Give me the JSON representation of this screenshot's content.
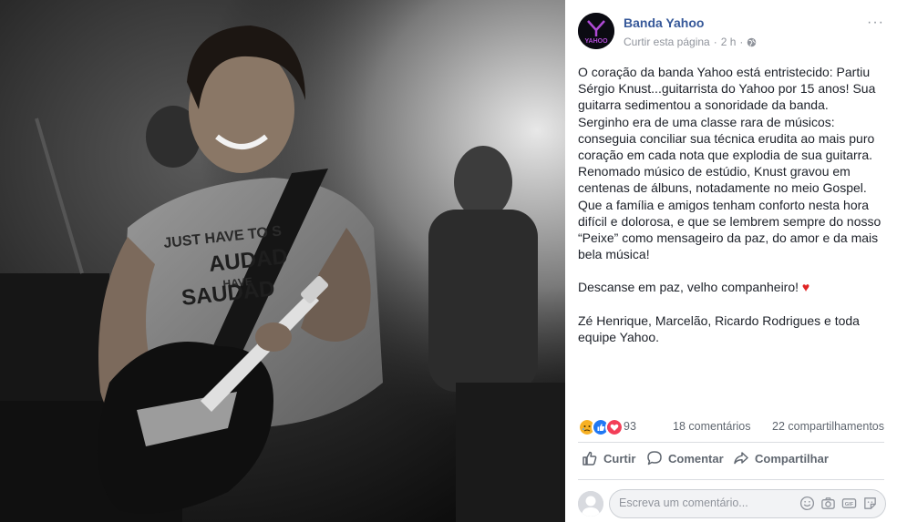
{
  "photo": {
    "shirt_text_1": "JUST HAVE TO S",
    "shirt_text_2": "AUDAD",
    "shirt_text_3": "HAVE",
    "shirt_text_4": "SAUDAD"
  },
  "post": {
    "page_name": "Banda Yahoo",
    "avatar_text": "YAHOO",
    "like_page_label": "Curtir esta página",
    "separator": "·",
    "time": "2 h",
    "separator2": "·",
    "more_label": "···",
    "paragraphs": [
      "O coração da banda Yahoo está entristecido: Partiu Sérgio Knust...guitarrista do Yahoo por 15 anos! Sua guitarra sedimentou a sonoridade da banda. Serginho era de uma classe rara de músicos: conseguia conciliar sua técnica erudita ao mais puro coração em cada nota que explodia de sua guitarra. Renomado músico de estúdio, Knust gravou em centenas de álbuns, notadamente no meio Gospel. Que a família e amigos tenham conforto nesta hora difícil e dolorosa, e que se lembrem sempre do nosso “Peixe” como mensageiro da paz, do amor e da mais bela música!",
      "Descanse em paz, velho companheiro!",
      "Zé Henrique, Marcelão, Ricardo Rodrigues e toda equipe Yahoo."
    ],
    "heart_emoji": "♥"
  },
  "reactions": {
    "count": "93",
    "comments": "18 comentários",
    "shares": "22 compartilhamentos",
    "colors": {
      "sad": "#f7b125",
      "like": "#2078f4",
      "love": "#f33e58"
    }
  },
  "actions": {
    "like": "Curtir",
    "comment": "Comentar",
    "share": "Compartilhar"
  },
  "comment_box": {
    "placeholder": "Escreva um comentário..."
  },
  "colors": {
    "link": "#365899",
    "muted": "#90949c",
    "avatar_purple": "#b04ad6"
  }
}
